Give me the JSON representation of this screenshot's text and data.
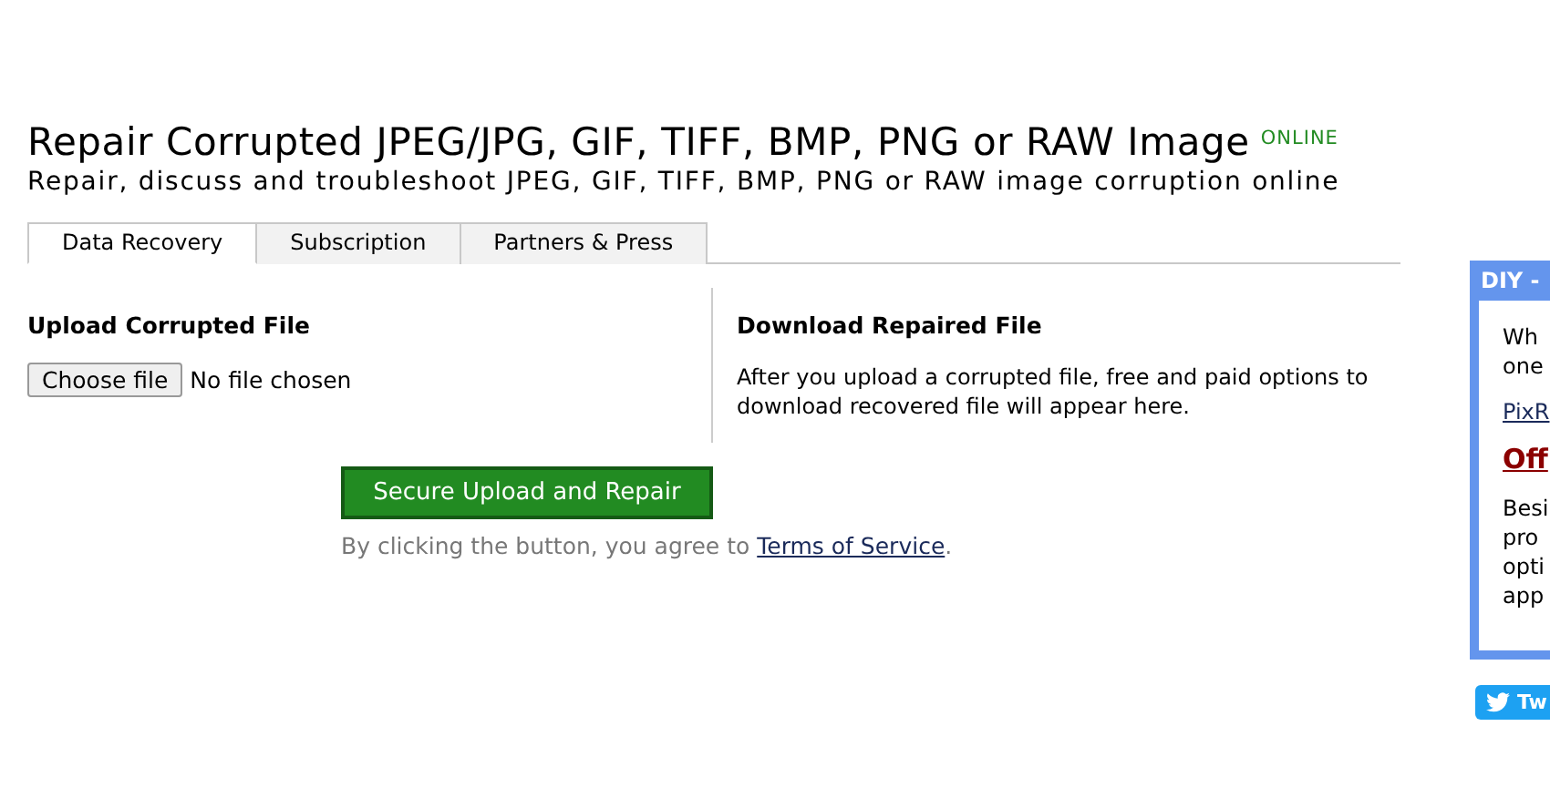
{
  "header": {
    "title": "Repair Corrupted JPEG/JPG, GIF, TIFF, BMP, PNG or RAW Image",
    "badge": "ONLINE",
    "subtitle": "Repair, discuss and troubleshoot JPEG, GIF, TIFF, BMP, PNG or RAW image corruption online"
  },
  "tabs": [
    {
      "label": "Data Recovery",
      "selected": true
    },
    {
      "label": "Subscription",
      "selected": false
    },
    {
      "label": "Partners & Press",
      "selected": false
    }
  ],
  "upload": {
    "heading": "Upload Corrupted File",
    "file_button": "Choose file",
    "file_status": "No file chosen"
  },
  "download": {
    "heading": "Download Repaired File",
    "text": "After you upload a corrupted file, free and paid options to download recovered file will appear here."
  },
  "submit": {
    "button": "Secure Upload and Repair",
    "note": "By clicking the button, you agree to ",
    "link": "Terms of Service",
    "note_end": "."
  },
  "sidebar": {
    "header": "DIY -",
    "intro_lines": [
      "Wh",
      "one"
    ],
    "link": "PixR",
    "heading": "Off",
    "body_lines": [
      "Besi",
      "pro",
      "opti",
      "app"
    ]
  },
  "tweet_button": "Tw"
}
